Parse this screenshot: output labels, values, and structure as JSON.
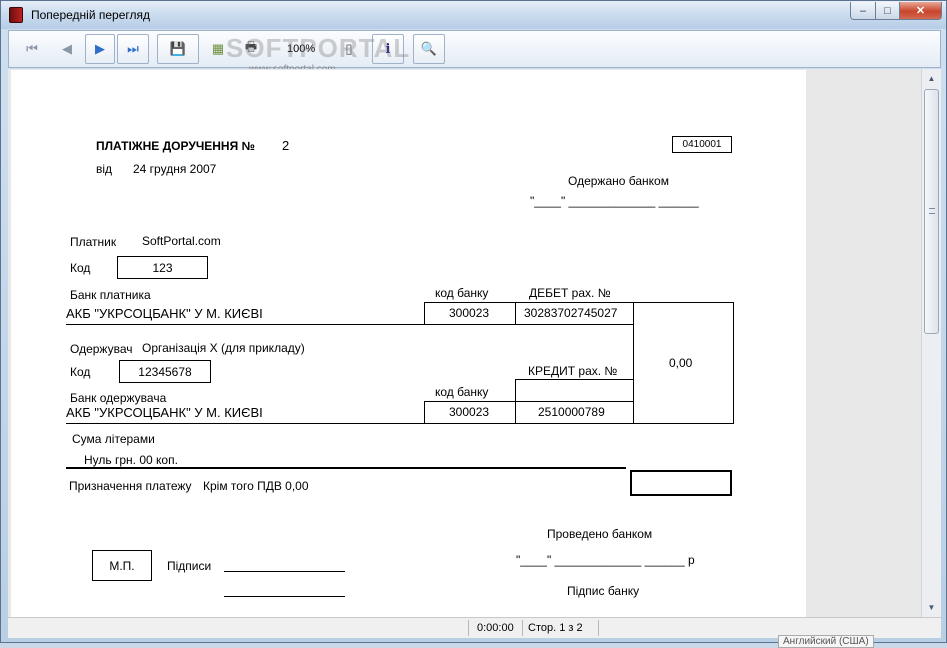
{
  "window": {
    "title": "Попередній перегляд",
    "min_label": "–",
    "max_label": "□",
    "close_label": "✕"
  },
  "toolbar": {
    "first_icon": "⏮",
    "prev_icon": "◀",
    "next_icon": "▶",
    "last_icon": "⏭",
    "save_icon": "💾",
    "export_icon": "▦",
    "print_icon": "🖶",
    "zoom_value": "100%",
    "page_setup_icon": "▯",
    "info_label": "i",
    "find_icon": "🔍"
  },
  "watermark": {
    "text": "SOFTPORTAL",
    "url": "www.softportal.com"
  },
  "document": {
    "title": "ПЛАТІЖНЕ ДОРУЧЕННЯ №",
    "number": "2",
    "form_code": "0410001",
    "date_prefix": "від",
    "date": "24  грудня  2007",
    "received_by_bank": "Одержано банком",
    "received_date_line": "\"____\" _____________ ______",
    "payer_label": "Платник",
    "payer_name": "SoftPortal.com",
    "code_label": "Код",
    "payer_code": "123",
    "payer_bank_label": "Банк платника",
    "bank_code_header": "код банку",
    "debit_header": "ДЕБЕТ рах. №",
    "payer_bank_name": "АКБ \"УКРСОЦБАНК\" У М. КИЄВІ",
    "payer_bank_code": "300023",
    "debit_account": "30283702745027",
    "amount": "0,00",
    "recipient_label": "Одержувач",
    "recipient_name": "Організація Х (для прикладу)",
    "recipient_code": "12345678",
    "credit_header": "КРЕДИТ рах. №",
    "recipient_bank_label": "Банк одержувача",
    "recipient_bank_name": "АКБ \"УКРСОЦБАНК\" У М. КИЄВІ",
    "recipient_bank_code": "300023",
    "credit_account": "2510000789",
    "amount_words_label": "Сума літерами",
    "amount_words": "Нуль грн. 00 коп.",
    "purpose_label": "Призначення платежу",
    "purpose": "Крім того ПДВ 0,00",
    "stamp_label": "М.П.",
    "signatures_label": "Підписи",
    "processed_by_bank": "Проведено банком",
    "processed_date_line": "\"____\" _____________ ______ р",
    "bank_signature": "Підпис банку"
  },
  "status": {
    "time": "0:00:00",
    "page": "Стор. 1 з 2",
    "language": "Английский (США)"
  }
}
